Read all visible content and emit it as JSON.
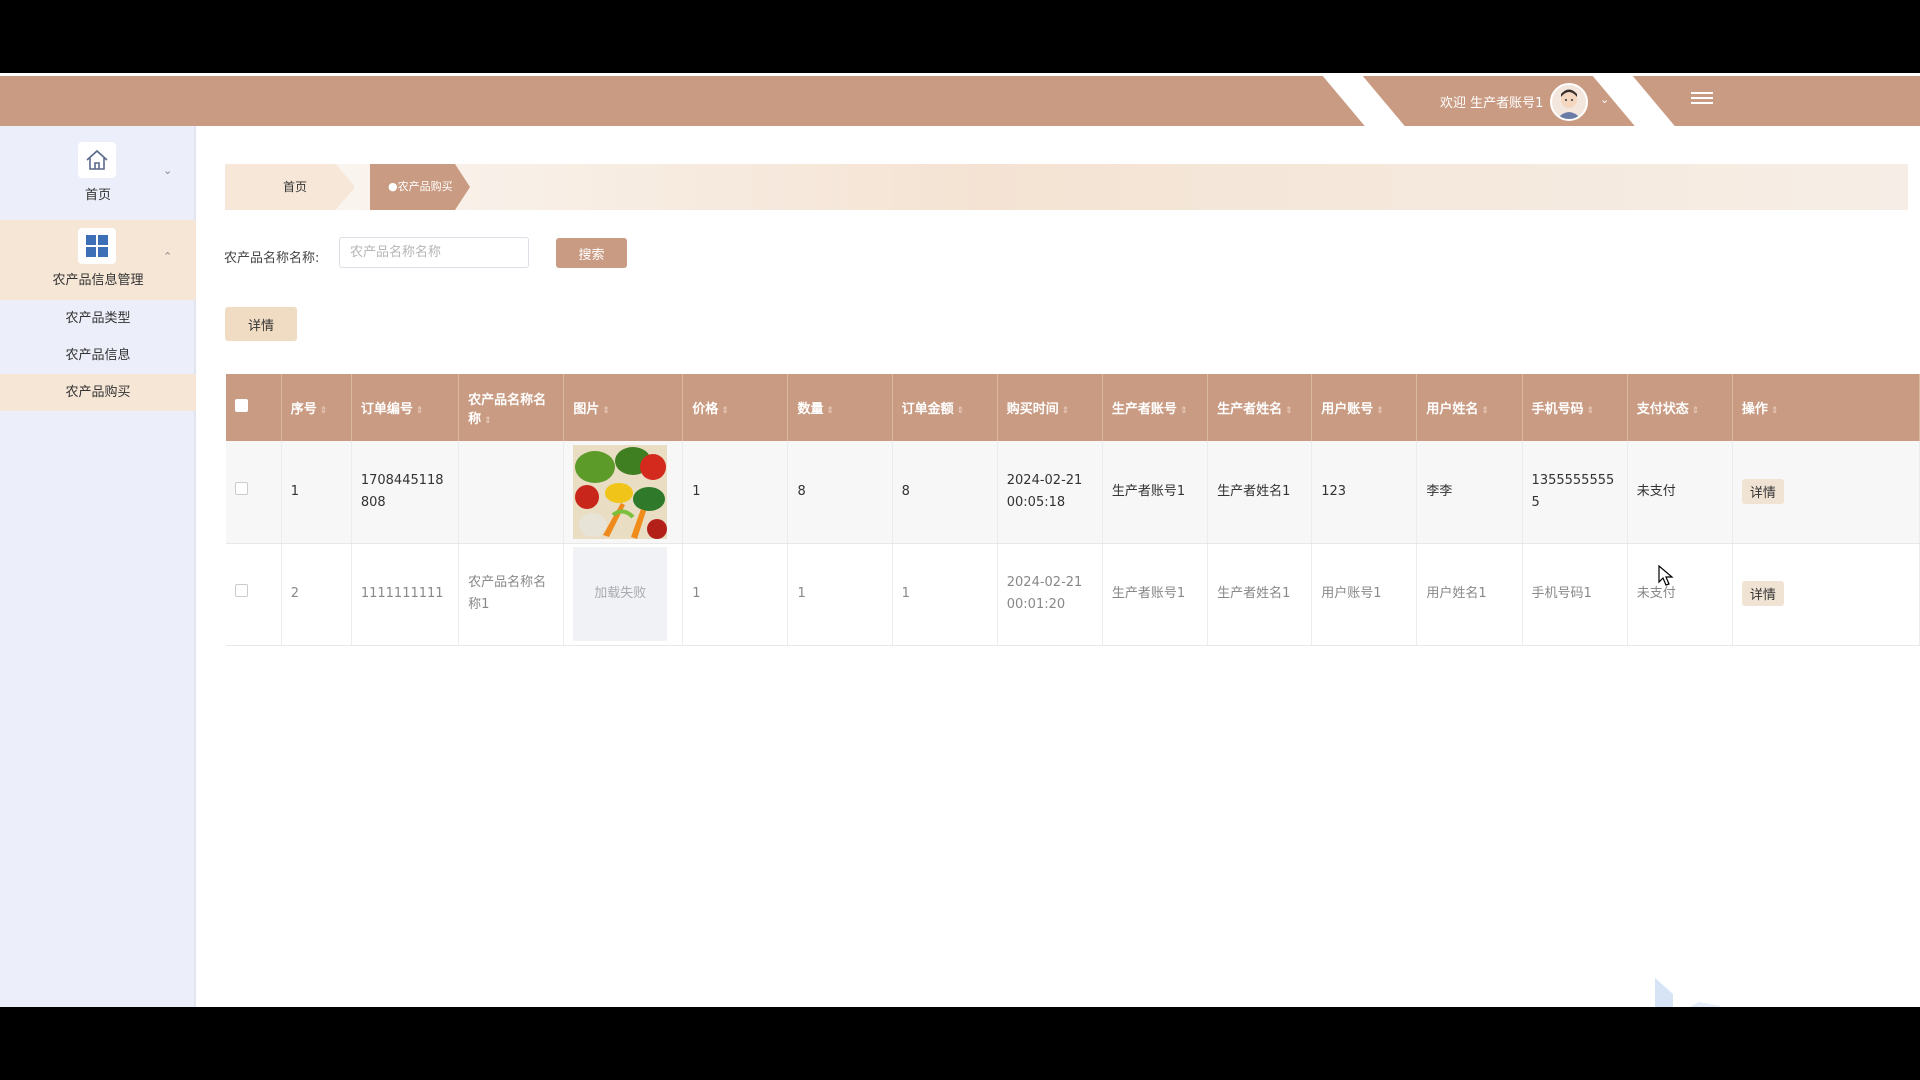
{
  "header": {
    "welcome": "欢迎 生产者账号1",
    "colors": {
      "bar": "#c99b82"
    }
  },
  "sidebar": {
    "home_label": "首页",
    "group_label": "农产品信息管理",
    "items": [
      {
        "label": "农产品类型",
        "active": false
      },
      {
        "label": "农产品信息",
        "active": false
      },
      {
        "label": "农产品购买",
        "active": true
      }
    ]
  },
  "breadcrumb": {
    "home": "首页",
    "current": "农产品购买"
  },
  "search": {
    "label": "农产品名称名称:",
    "placeholder": "农产品名称名称",
    "button": "搜索"
  },
  "toolbar": {
    "detail_label": "详情"
  },
  "table": {
    "columns": [
      "序号",
      "订单编号",
      "农产品名称名称",
      "图片",
      "价格",
      "数量",
      "订单金额",
      "购买时间",
      "生产者账号",
      "生产者姓名",
      "用户账号",
      "用户姓名",
      "手机号码",
      "支付状态",
      "操作"
    ],
    "rows": [
      {
        "index": "1",
        "order_no": "1708445118808",
        "product_name": "",
        "image": "vegetables",
        "price": "1",
        "quantity": "8",
        "amount": "8",
        "purchase_time": "2024-02-21 00:05:18",
        "producer_account": "生产者账号1",
        "producer_name": "生产者姓名1",
        "user_account": "123",
        "user_name": "李李",
        "phone": "13555555555",
        "pay_status": "未支付",
        "action": "详情"
      },
      {
        "index": "2",
        "order_no": "1111111111",
        "product_name": "农产品名称名称1",
        "image_text": "加载失败",
        "price": "1",
        "quantity": "1",
        "amount": "1",
        "purchase_time": "2024-02-21 00:01:20",
        "producer_account": "生产者账号1",
        "producer_name": "生产者姓名1",
        "user_account": "用户账号1",
        "user_name": "用户姓名1",
        "phone": "手机号码1",
        "pay_status": "未支付",
        "action": "详情"
      }
    ]
  }
}
